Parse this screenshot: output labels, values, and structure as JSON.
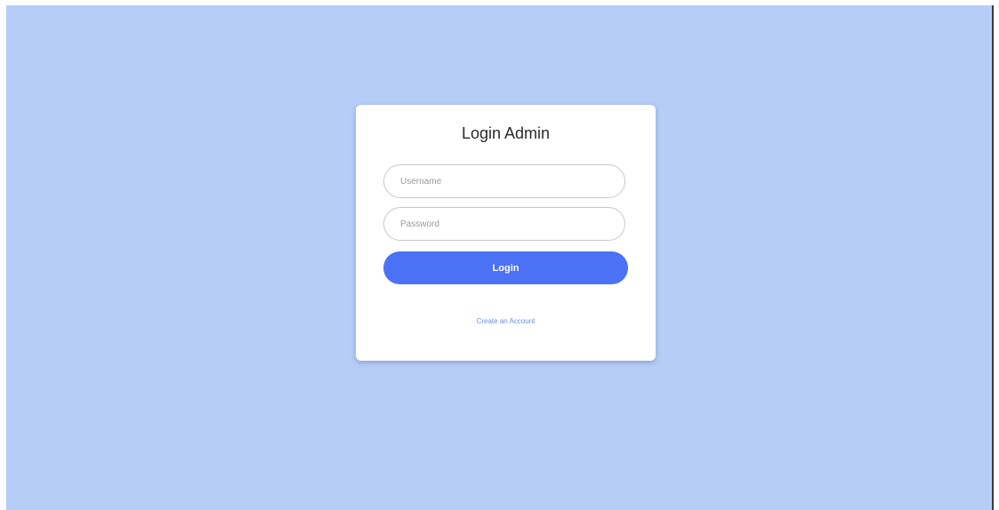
{
  "colors": {
    "background": "#b6cdf7",
    "card": "#ffffff",
    "primary": "#4b72f5",
    "link": "#6b8fd6"
  },
  "login_form": {
    "title": "Login Admin",
    "username_placeholder": "Username",
    "username_value": "",
    "password_placeholder": "Password",
    "password_value": "",
    "login_label": "Login",
    "create_account_label": "Create an Account"
  }
}
